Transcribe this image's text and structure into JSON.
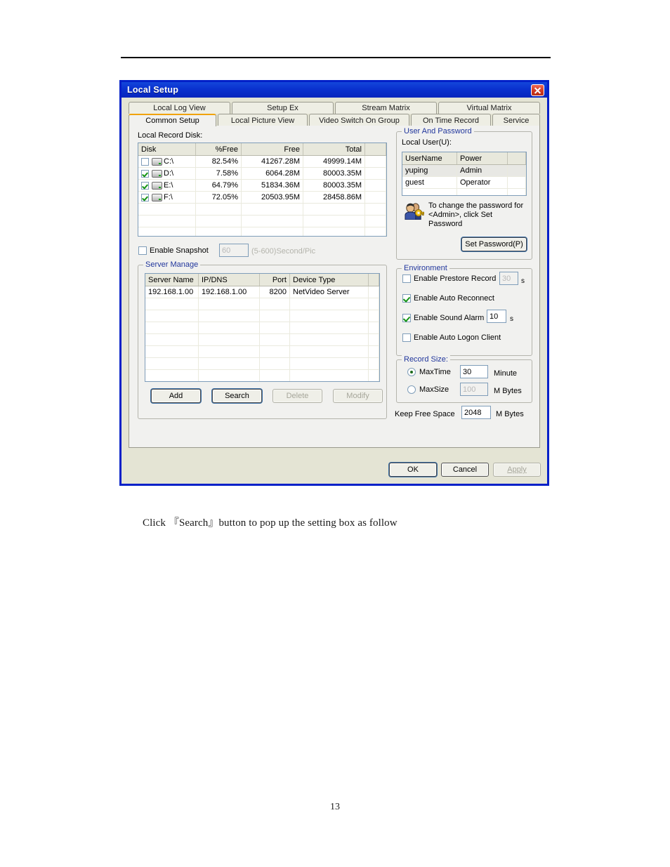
{
  "document": {
    "caption": "Click 『Search』button to pop up the setting box as follow",
    "page_number": "13"
  },
  "dialog": {
    "title": "Local Setup",
    "close_label": "",
    "tabs_row1": [
      {
        "label": "Local Log View",
        "active": false
      },
      {
        "label": "Setup Ex",
        "active": false
      },
      {
        "label": "Stream Matrix",
        "active": false
      },
      {
        "label": "Virtual Matrix",
        "active": false
      }
    ],
    "tabs_row2": [
      {
        "label": "Common Setup",
        "active": true
      },
      {
        "label": "Local Picture View",
        "active": false
      },
      {
        "label": "Video Switch On Group",
        "active": false
      },
      {
        "label": "On Time Record",
        "active": false
      },
      {
        "label": "Service",
        "active": false
      }
    ],
    "footer": {
      "ok": "OK",
      "cancel": "Cancel",
      "apply": "Apply"
    }
  },
  "local_record_disk": {
    "label": "Local Record Disk:",
    "columns": [
      "Disk",
      "%Free",
      "Free",
      "Total"
    ],
    "rows": [
      {
        "checked": false,
        "disk": "C:\\",
        "pct_free": "82.54%",
        "free": "41267.28M",
        "total": "49999.14M"
      },
      {
        "checked": true,
        "disk": "D:\\",
        "pct_free": "7.58%",
        "free": "6064.28M",
        "total": "80003.35M"
      },
      {
        "checked": true,
        "disk": "E:\\",
        "pct_free": "64.79%",
        "free": "51834.36M",
        "total": "80003.35M"
      },
      {
        "checked": true,
        "disk": "F:\\",
        "pct_free": "72.05%",
        "free": "20503.95M",
        "total": "28458.86M"
      }
    ]
  },
  "snapshot": {
    "checkbox_label": "Enable Snapshot",
    "checked": false,
    "interval_value": "60",
    "hint": "(5-600)Second/Pic"
  },
  "server_manage": {
    "title": "Server Manage",
    "columns": [
      "Server Name",
      "IP/DNS",
      "Port",
      "Device Type"
    ],
    "rows": [
      {
        "server_name": "192.168.1.00",
        "ip_dns": "192.168.1.00",
        "port": "8200",
        "device_type": "NetVideo Server"
      }
    ],
    "buttons": {
      "add": "Add",
      "search": "Search",
      "delete": "Delete",
      "modify": "Modify"
    }
  },
  "user_and_password": {
    "title": "User And Password",
    "local_user_label": "Local User(U):",
    "columns": [
      "UserName",
      "Power"
    ],
    "rows": [
      {
        "username": "yuping",
        "power": "Admin",
        "selected": true
      },
      {
        "username": "guest",
        "power": "Operator",
        "selected": false
      }
    ],
    "hint": "To change the password for <Admin>, click Set Password",
    "set_password_button": "Set Password(P)"
  },
  "environment": {
    "title": "Environment",
    "items": [
      {
        "label": "Enable Prestore Record",
        "checked": false,
        "value": "30",
        "unit": "s",
        "value_disabled": true
      },
      {
        "label": "Enable Auto Reconnect",
        "checked": true
      },
      {
        "label": "Enable Sound Alarm",
        "checked": true,
        "value": "10",
        "unit": "s",
        "value_disabled": false
      },
      {
        "label": "Enable Auto Logon Client",
        "checked": false
      }
    ]
  },
  "record_size": {
    "title": "Record Size:",
    "max_time": {
      "label": "MaxTime",
      "selected": true,
      "value": "30",
      "unit": "Minute"
    },
    "max_size": {
      "label": "MaxSize",
      "selected": false,
      "value": "100",
      "unit": "M Bytes"
    }
  },
  "keep_free_space": {
    "label": "Keep Free Space",
    "value": "2048",
    "unit": "M Bytes"
  },
  "colors": {
    "title_blue": "#0a31cf",
    "dialog_border": "#0320c8",
    "dialog_face": "#e4e4d4",
    "tab_page": "#f1f1ef",
    "group_title": "#21369c",
    "active_tab_accent": "#f0a30a",
    "check_green": "#149414",
    "close_red": "#d23a22"
  }
}
